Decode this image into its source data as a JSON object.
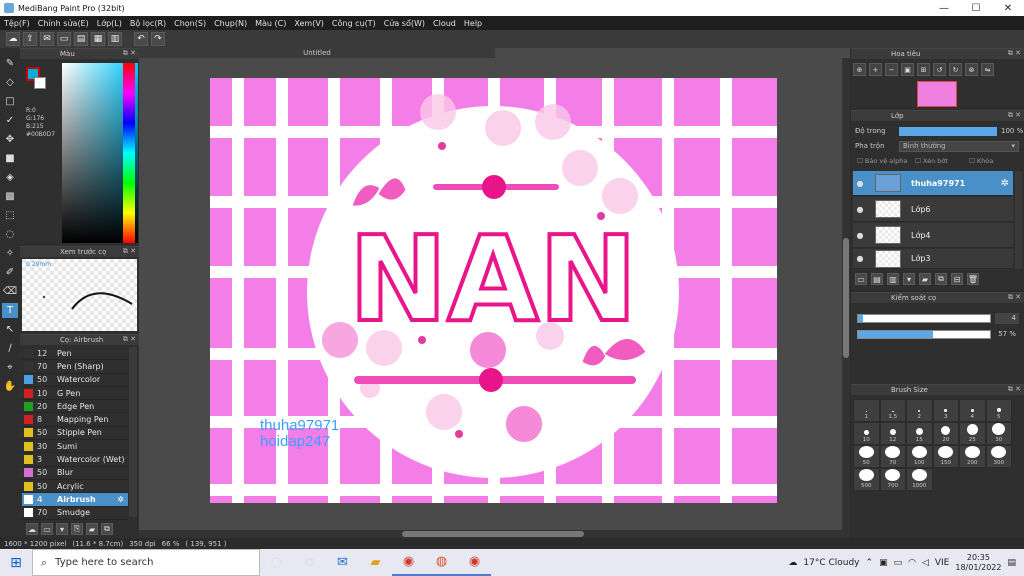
{
  "window": {
    "title": "MediBang Paint Pro (32bit)",
    "minimize": "—",
    "maximize": "☐",
    "close": "✕"
  },
  "menu": [
    "Tệp(F)",
    "Chỉnh sửa(E)",
    "Lớp(L)",
    "Bộ lọc(R)",
    "Chọn(S)",
    "Chụp(N)",
    "Màu (C)",
    "Xem(V)",
    "Công cụ(T)",
    "Cửa sổ(W)",
    "Cloud",
    "Help"
  ],
  "color_panel": {
    "title": "Màu",
    "r": "R:0",
    "g": "G:176",
    "b": "B:215",
    "hex": "#00B0D7",
    "fg_color": "#00b0d7"
  },
  "preview_panel": {
    "title": "Xem trước cọ",
    "size": "0.29mm"
  },
  "brush_panel": {
    "title": "Cọ: Airbrush",
    "brushes": [
      {
        "size": "12",
        "name": "Pen",
        "color": "#333333"
      },
      {
        "size": "70",
        "name": "Pen (Sharp)",
        "color": "#333333"
      },
      {
        "size": "50",
        "name": "Watercolor",
        "color": "#4aa0e0"
      },
      {
        "size": "10",
        "name": "G Pen",
        "color": "#d02020"
      },
      {
        "size": "20",
        "name": "Edge Pen",
        "color": "#20a020"
      },
      {
        "size": "8",
        "name": "Mapping Pen",
        "color": "#d02020"
      },
      {
        "size": "50",
        "name": "Stipple Pen",
        "color": "#e0c020"
      },
      {
        "size": "30",
        "name": "Sumi",
        "color": "#e0c020"
      },
      {
        "size": "3",
        "name": "Watercolor (Wet)",
        "color": "#e0c020"
      },
      {
        "size": "50",
        "name": "Blur",
        "color": "#d070d0"
      },
      {
        "size": "50",
        "name": "Acrylic",
        "color": "#e0c020"
      },
      {
        "size": "4",
        "name": "Airbrush",
        "color": "#ffffff"
      },
      {
        "size": "70",
        "name": "Smudge",
        "color": "#ffffff"
      }
    ]
  },
  "document": {
    "tab": "Untitled",
    "watermark_1": "thuha97971",
    "watermark_2": "hoidap247",
    "art_text": "NAN"
  },
  "navigator": {
    "title": "Hoa tiêu"
  },
  "layer_panel": {
    "title": "Lớp",
    "opacity_label": "Độ trong",
    "opacity_value": "100 %",
    "blend_label": "Pha trộn",
    "blend_value": "Bình thường",
    "protect_alpha": "Bảo vệ alpha",
    "clipping": "Xén bớt",
    "lock": "Khóa",
    "layers": [
      {
        "name": "thuha97971"
      },
      {
        "name": "Lớp6"
      },
      {
        "name": "Lớp4"
      },
      {
        "name": "Lớp3"
      }
    ]
  },
  "brush_control": {
    "title": "Kiểm soát cọ",
    "size_value": "4",
    "opacity_value": "57 %",
    "opacity_fraction": 0.57
  },
  "brush_size_panel": {
    "title": "Brush Size",
    "sizes": [
      "1",
      "1.5",
      "2",
      "3",
      "4",
      "5",
      "10",
      "12",
      "15",
      "20",
      "25",
      "30",
      "50",
      "70",
      "100",
      "150",
      "200",
      "300",
      "500",
      "700",
      "1000"
    ]
  },
  "status": {
    "dimensions": "1600 * 1200 pixel",
    "physical": "(11.6 * 8.7cm)",
    "dpi": "350 dpi",
    "zoom": "66 %",
    "coords": "( 139, 951 )"
  },
  "taskbar": {
    "search_placeholder": "Type here to search",
    "weather": "17°C  Cloudy",
    "lang": "VIE",
    "time": "20:35",
    "date": "18/01/2022"
  }
}
